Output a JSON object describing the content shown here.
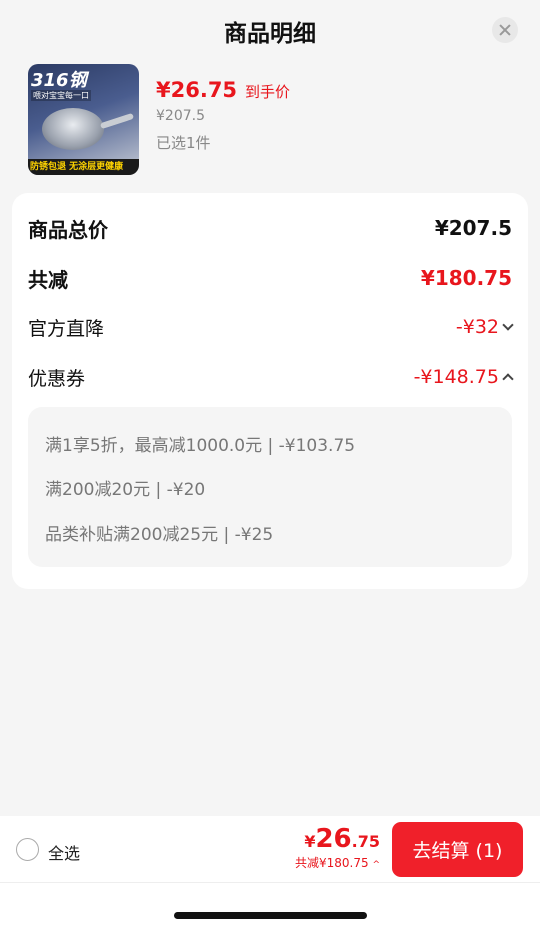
{
  "header": {
    "title": "商品明细"
  },
  "product": {
    "thumb_badge": "316钢",
    "thumb_sub": "喂对宝宝每一口",
    "thumb_banner": "防锈包退 无涂层更健康",
    "price": "¥26.75",
    "price_tag": "到手价",
    "original_price": "¥207.5",
    "selected": "已选1件"
  },
  "summary": {
    "total_label": "商品总价",
    "total_value": "¥207.5",
    "reduce_label": "共减",
    "reduce_value": "¥180.75",
    "direct_label": "官方直降",
    "direct_value": "-¥32",
    "coupon_label": "优惠券",
    "coupon_value": "-¥148.75",
    "coupons": [
      "满1享5折，最高减1000.0元 | -¥103.75",
      "满200减20元 | -¥20",
      "品类补贴满200减25元 | -¥25"
    ]
  },
  "bottom": {
    "select_all": "全选",
    "currency": "¥",
    "price_int": "26",
    "price_dec": ".75",
    "reduce_text": "共减¥180.75",
    "checkout": "去结算 (1)"
  },
  "colors": {
    "accent": "#e8161d",
    "checkout_bg": "#f0202a"
  }
}
